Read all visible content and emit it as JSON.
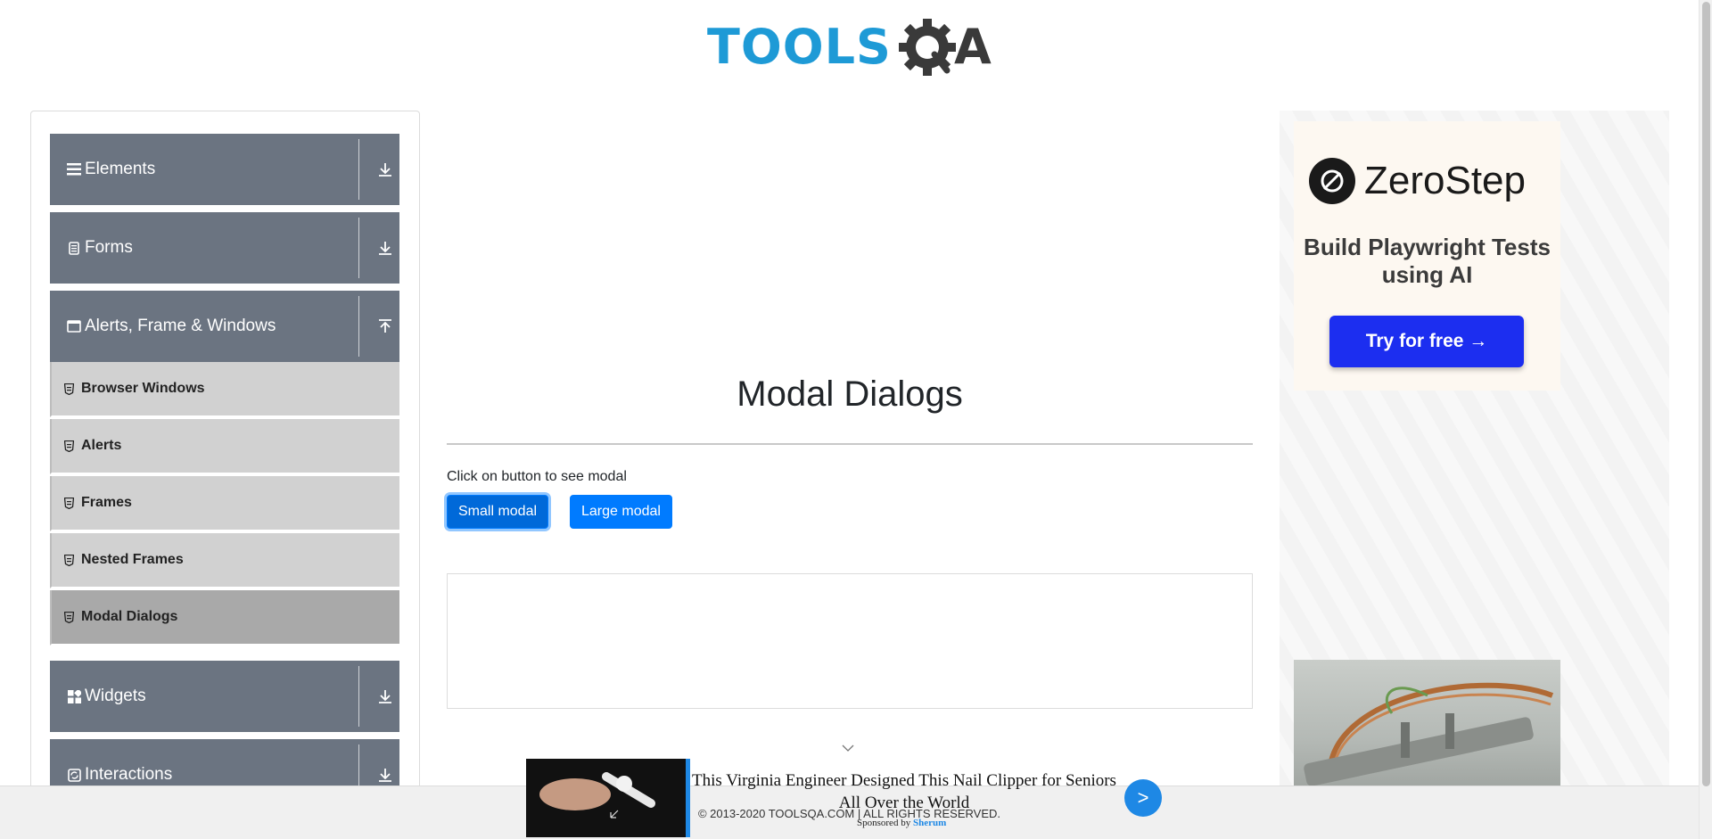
{
  "header": {
    "logo_text_left": "TOOLS",
    "logo_text_right": "A"
  },
  "sidebar": {
    "groups": [
      {
        "label": "Elements",
        "icon": "hamburger-icon",
        "expanded": false
      },
      {
        "label": "Forms",
        "icon": "document-icon",
        "expanded": false
      },
      {
        "label": "Alerts, Frame & Windows",
        "icon": "window-icon",
        "expanded": true
      },
      {
        "label": "Widgets",
        "icon": "widgets-icon",
        "expanded": false
      },
      {
        "label": "Interactions",
        "icon": "interactions-icon",
        "expanded": false
      }
    ],
    "items": [
      {
        "label": "Browser Windows",
        "active": false
      },
      {
        "label": "Alerts",
        "active": false
      },
      {
        "label": "Frames",
        "active": false
      },
      {
        "label": "Nested Frames",
        "active": false
      },
      {
        "label": "Modal Dialogs",
        "active": true
      }
    ]
  },
  "main": {
    "title": "Modal Dialogs",
    "hint": "Click on button to see modal",
    "small_button": "Small modal",
    "large_button": "Large modal"
  },
  "right_ad": {
    "brand": "ZeroStep",
    "tagline": "Build Playwright Tests using AI",
    "cta": "Try for free →"
  },
  "sticky_ad": {
    "headline": "This Virginia Engineer Designed This Nail Clipper for Seniors All Over the World",
    "next": ">",
    "sponsored_by": "Sponsored by",
    "sponsor": "Sherum"
  },
  "footer": {
    "text": "© 2013-2020 TOOLSQA.COM | ALL RIGHTS RESERVED."
  },
  "colors": {
    "group_bg": "#6b7481",
    "submenu_bg": "#d1d1d1",
    "active_bg": "#a9a9a9",
    "primary": "#007bff",
    "logo_blue": "#1e9ad6"
  }
}
